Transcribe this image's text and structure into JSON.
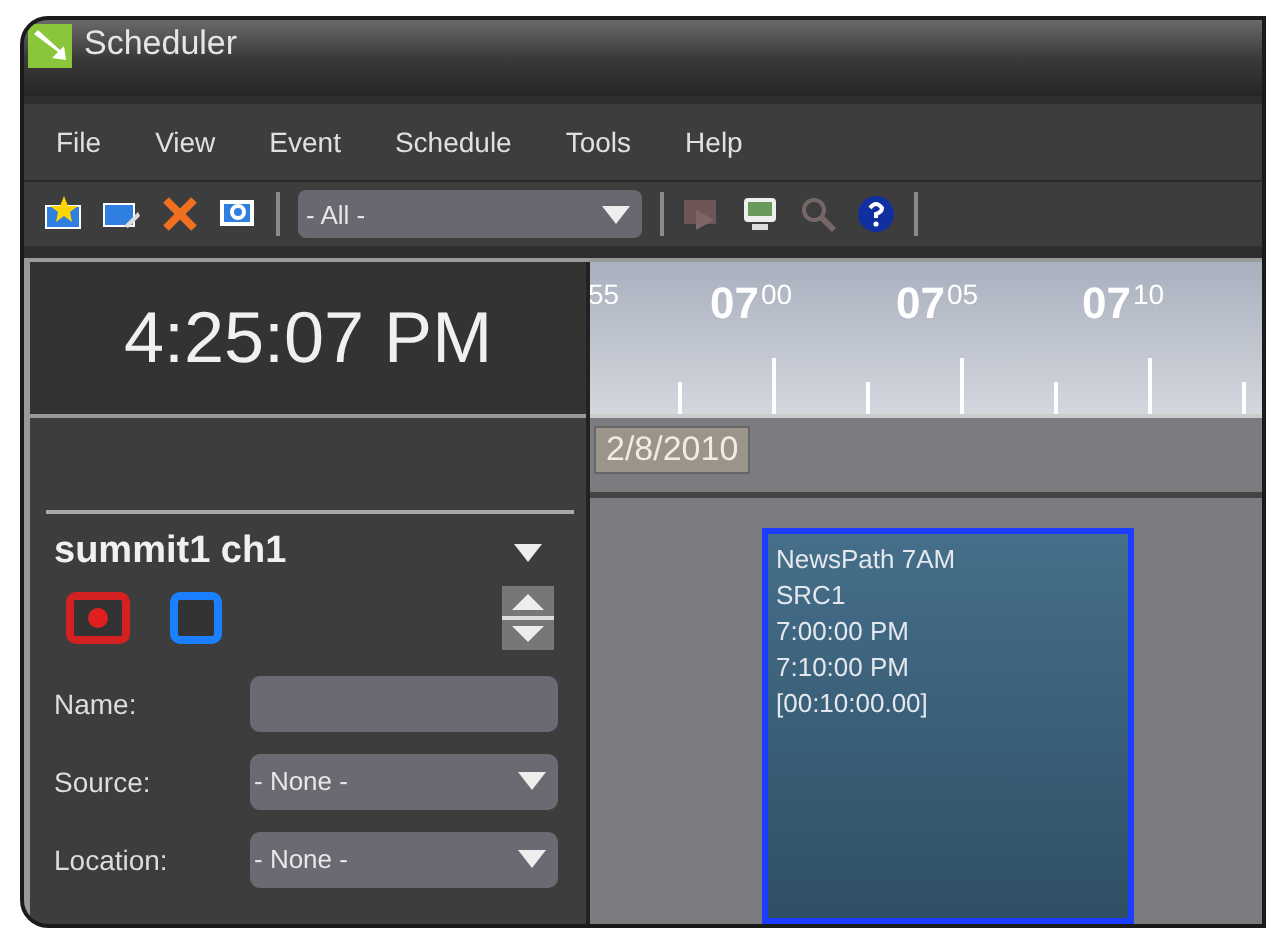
{
  "window": {
    "title": "Scheduler"
  },
  "menu": [
    {
      "label": "File"
    },
    {
      "label": "View"
    },
    {
      "label": "Event"
    },
    {
      "label": "Schedule"
    },
    {
      "label": "Tools"
    },
    {
      "label": "Help"
    }
  ],
  "toolbar": [
    {
      "kind": "new",
      "disabled": false
    },
    {
      "kind": "edit",
      "disabled": false
    },
    {
      "kind": "delete",
      "disabled": false
    },
    {
      "kind": "view",
      "disabled": false
    },
    {
      "kind": "separator"
    },
    {
      "kind": "dropdown",
      "value": "- All -"
    },
    {
      "kind": "separator"
    },
    {
      "kind": "play",
      "disabled": true
    },
    {
      "kind": "monitor",
      "disabled": false
    },
    {
      "kind": "search",
      "disabled": true
    },
    {
      "kind": "help",
      "disabled": false
    },
    {
      "kind": "separator"
    }
  ],
  "clock": "4:25:07 PM",
  "timeline": {
    "ticks": [
      {
        "minute": "55"
      },
      {
        "hour": "07",
        "minute": "00"
      },
      {
        "hour": "07",
        "minute": "05"
      },
      {
        "hour": "07",
        "minute": "10"
      }
    ],
    "date": "2/8/2010"
  },
  "event": {
    "selected": true,
    "lines": [
      "NewsPath 7AM",
      "SRC1",
      "7:00:00 PM",
      "7:10:00 PM",
      "[00:10:00.00]"
    ]
  },
  "channel": {
    "name": "summit1 ch1",
    "fields": [
      {
        "kind": "text",
        "label": "Name:"
      },
      {
        "kind": "select",
        "label": "Source:",
        "value": "- None -"
      },
      {
        "kind": "select",
        "label": "Location:",
        "value": "- None -"
      }
    ]
  }
}
